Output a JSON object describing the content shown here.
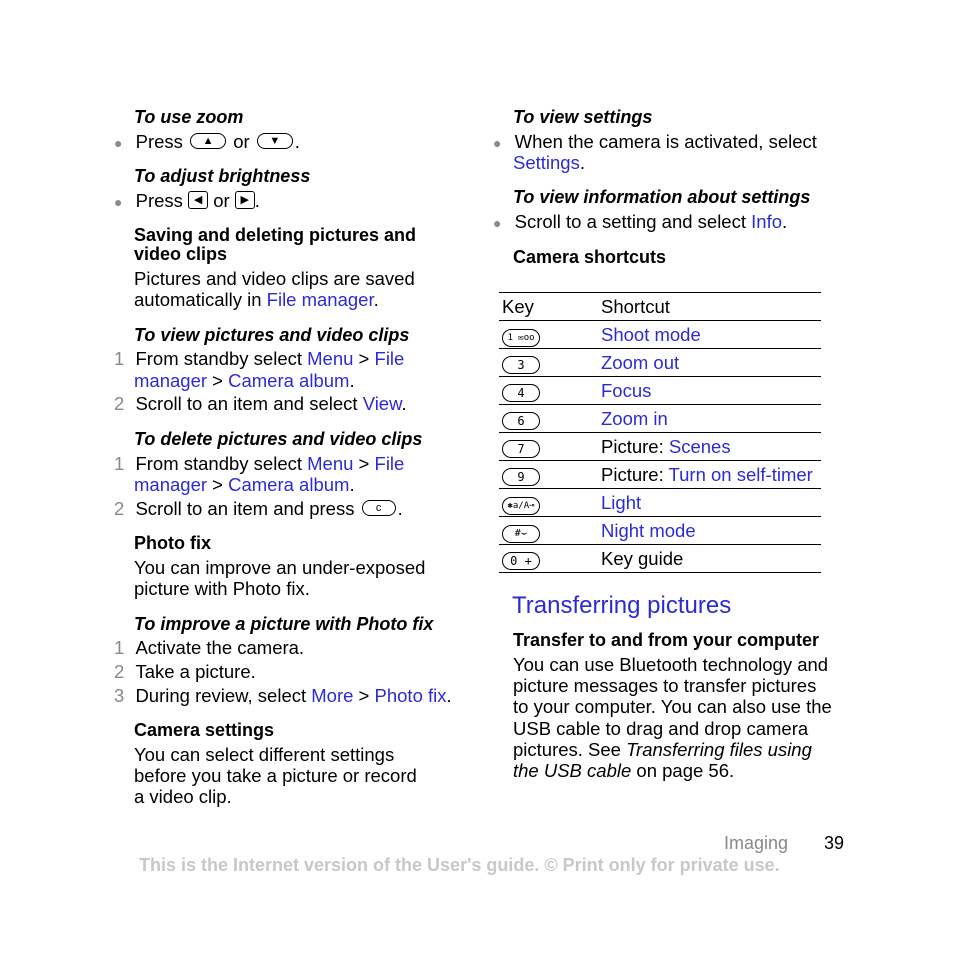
{
  "left": {
    "zoom": {
      "heading": "To use zoom",
      "press": "Press",
      "or": "or",
      "end": ".",
      "key_up": "▲",
      "key_down": "▼"
    },
    "brightness": {
      "heading": "To adjust brightness",
      "press": "Press",
      "or": "or",
      "end": ".",
      "key_left": "◀",
      "key_right": "▶"
    },
    "saving": {
      "heading_line1": "Saving and deleting pictures and",
      "heading_line2": "video clips",
      "text_line1": "Pictures and video clips are saved",
      "text_line2_pre": "automatically in ",
      "text_line2_link": "File manager",
      "text_line2_post": "."
    },
    "view_clips": {
      "heading": "To view pictures and video clips",
      "steps": [
        {
          "num": "1",
          "pre": "From standby select ",
          "link1": "Menu",
          "sep": " > ",
          "link2": "File",
          "line2_link": "manager",
          "line2_sep": " > ",
          "line2_link2": "Camera album",
          "line2_post": "."
        },
        {
          "num": "2",
          "pre": "Scroll to an item and select ",
          "link": "View",
          "post": "."
        }
      ]
    },
    "delete_clips": {
      "heading": "To delete pictures and video clips",
      "steps": [
        {
          "num": "1",
          "pre": "From standby select ",
          "link1": "Menu",
          "sep": " > ",
          "link2": "File",
          "line2_link": "manager",
          "line2_sep": " > ",
          "line2_link2": "Camera album",
          "line2_post": "."
        },
        {
          "num": "2",
          "pre": "Scroll to an item and press ",
          "key": "c",
          "post": "."
        }
      ]
    },
    "photo_fix": {
      "heading": "Photo fix",
      "text_line1": "You can improve an under-exposed",
      "text_line2": "picture with Photo fix."
    },
    "improve": {
      "heading": "To improve a picture with Photo fix",
      "steps": [
        {
          "num": "1",
          "text": "Activate the camera."
        },
        {
          "num": "2",
          "text": "Take a picture."
        },
        {
          "num": "3",
          "pre": "During review, select ",
          "link1": "More",
          "sep": " > ",
          "link2": "Photo fix",
          "post": "."
        }
      ]
    },
    "camera_settings": {
      "heading": "Camera settings",
      "text_line1": "You can select different settings",
      "text_line2": "before you take a picture or record",
      "text_line3": "a video clip."
    }
  },
  "right": {
    "view_settings": {
      "heading": "To view settings",
      "line1": "When the camera is activated, select",
      "link": "Settings",
      "post": "."
    },
    "view_info": {
      "heading": "To view information about settings",
      "pre": "Scroll to a setting and select ",
      "link": "Info",
      "post": "."
    },
    "shortcuts": {
      "heading": "Camera shortcuts",
      "col_key": "Key",
      "col_shortcut": "Shortcut",
      "rows": [
        {
          "key": "1 ✉oo",
          "prefix": "",
          "link": "Shoot mode"
        },
        {
          "key": "3",
          "prefix": "",
          "link": "Zoom out"
        },
        {
          "key": "4",
          "prefix": "",
          "link": "Focus"
        },
        {
          "key": "6",
          "prefix": "",
          "link": "Zoom in"
        },
        {
          "key": "7",
          "prefix": "Picture: ",
          "link": "Scenes"
        },
        {
          "key": "9",
          "prefix": "Picture: ",
          "link": "Turn on self-timer"
        },
        {
          "key": "✱a/A⊸",
          "prefix": "",
          "link": "Light"
        },
        {
          "key": "#⌣",
          "prefix": "",
          "link": "Night mode"
        },
        {
          "key": "0 +",
          "prefix": "Key guide",
          "link": ""
        }
      ]
    },
    "transferring": {
      "title": "Transferring pictures",
      "subheading": "Transfer to and from your computer",
      "line1": "You can use Bluetooth technology and",
      "line2": "picture messages to transfer pictures",
      "line3": "to your computer. You can also use the",
      "line4": "USB cable to drag and drop camera",
      "line5_pre": "pictures. See ",
      "line5_it": "Transferring files using",
      "line6_it": "the USB cable",
      "line6_post": " on page 56."
    }
  },
  "footer": {
    "section": "Imaging",
    "page": "39",
    "notice": "This is the Internet version of the User's guide. © Print only for private use."
  }
}
